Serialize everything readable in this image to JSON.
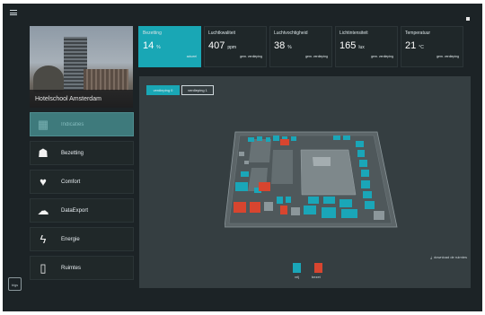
{
  "hero": {
    "caption": "Hotelschool Amsterdam"
  },
  "sidebar": {
    "items": [
      {
        "label": "Indicaties",
        "icon": "building-icon",
        "glyph": "▦",
        "active": true
      },
      {
        "label": "Bezetting",
        "icon": "people-icon",
        "glyph": "☗",
        "active": false
      },
      {
        "label": "Comfort",
        "icon": "heartbeat-icon",
        "glyph": "♥",
        "active": false
      },
      {
        "label": "DataExport",
        "icon": "cloud-download-icon",
        "glyph": "☁",
        "active": false
      },
      {
        "label": "Energie",
        "icon": "lightning-icon",
        "glyph": "ϟ",
        "active": false
      },
      {
        "label": "Ruimtes",
        "icon": "door-icon",
        "glyph": "▯",
        "active": false
      }
    ]
  },
  "tiles": [
    {
      "label": "Bezetting",
      "value": "14",
      "unit": "%",
      "sub": "actueel",
      "active": true
    },
    {
      "label": "Luchtkwaliteit",
      "value": "407",
      "unit": "ppm",
      "sub": "gem. verdieping",
      "active": false
    },
    {
      "label": "Luchtvochtigheid",
      "value": "38",
      "unit": "%",
      "sub": "gem. verdieping",
      "active": false
    },
    {
      "label": "Lichtintensiteit",
      "value": "165",
      "unit": "lux",
      "sub": "gem. verdieping",
      "active": false
    },
    {
      "label": "Temperatuur",
      "value": "21",
      "unit": "°C",
      "sub": "gem. verdieping",
      "active": false
    }
  ],
  "floor_buttons": [
    {
      "label": "verdieping 0",
      "active": true
    },
    {
      "label": "verdieping 1",
      "active": false
    }
  ],
  "download_label": "download de ruimtes",
  "legend": [
    {
      "label": "vrij",
      "color": "#1aa6b8"
    },
    {
      "label": "bezet",
      "color": "#d8452f"
    }
  ],
  "logo_text": "bigs"
}
